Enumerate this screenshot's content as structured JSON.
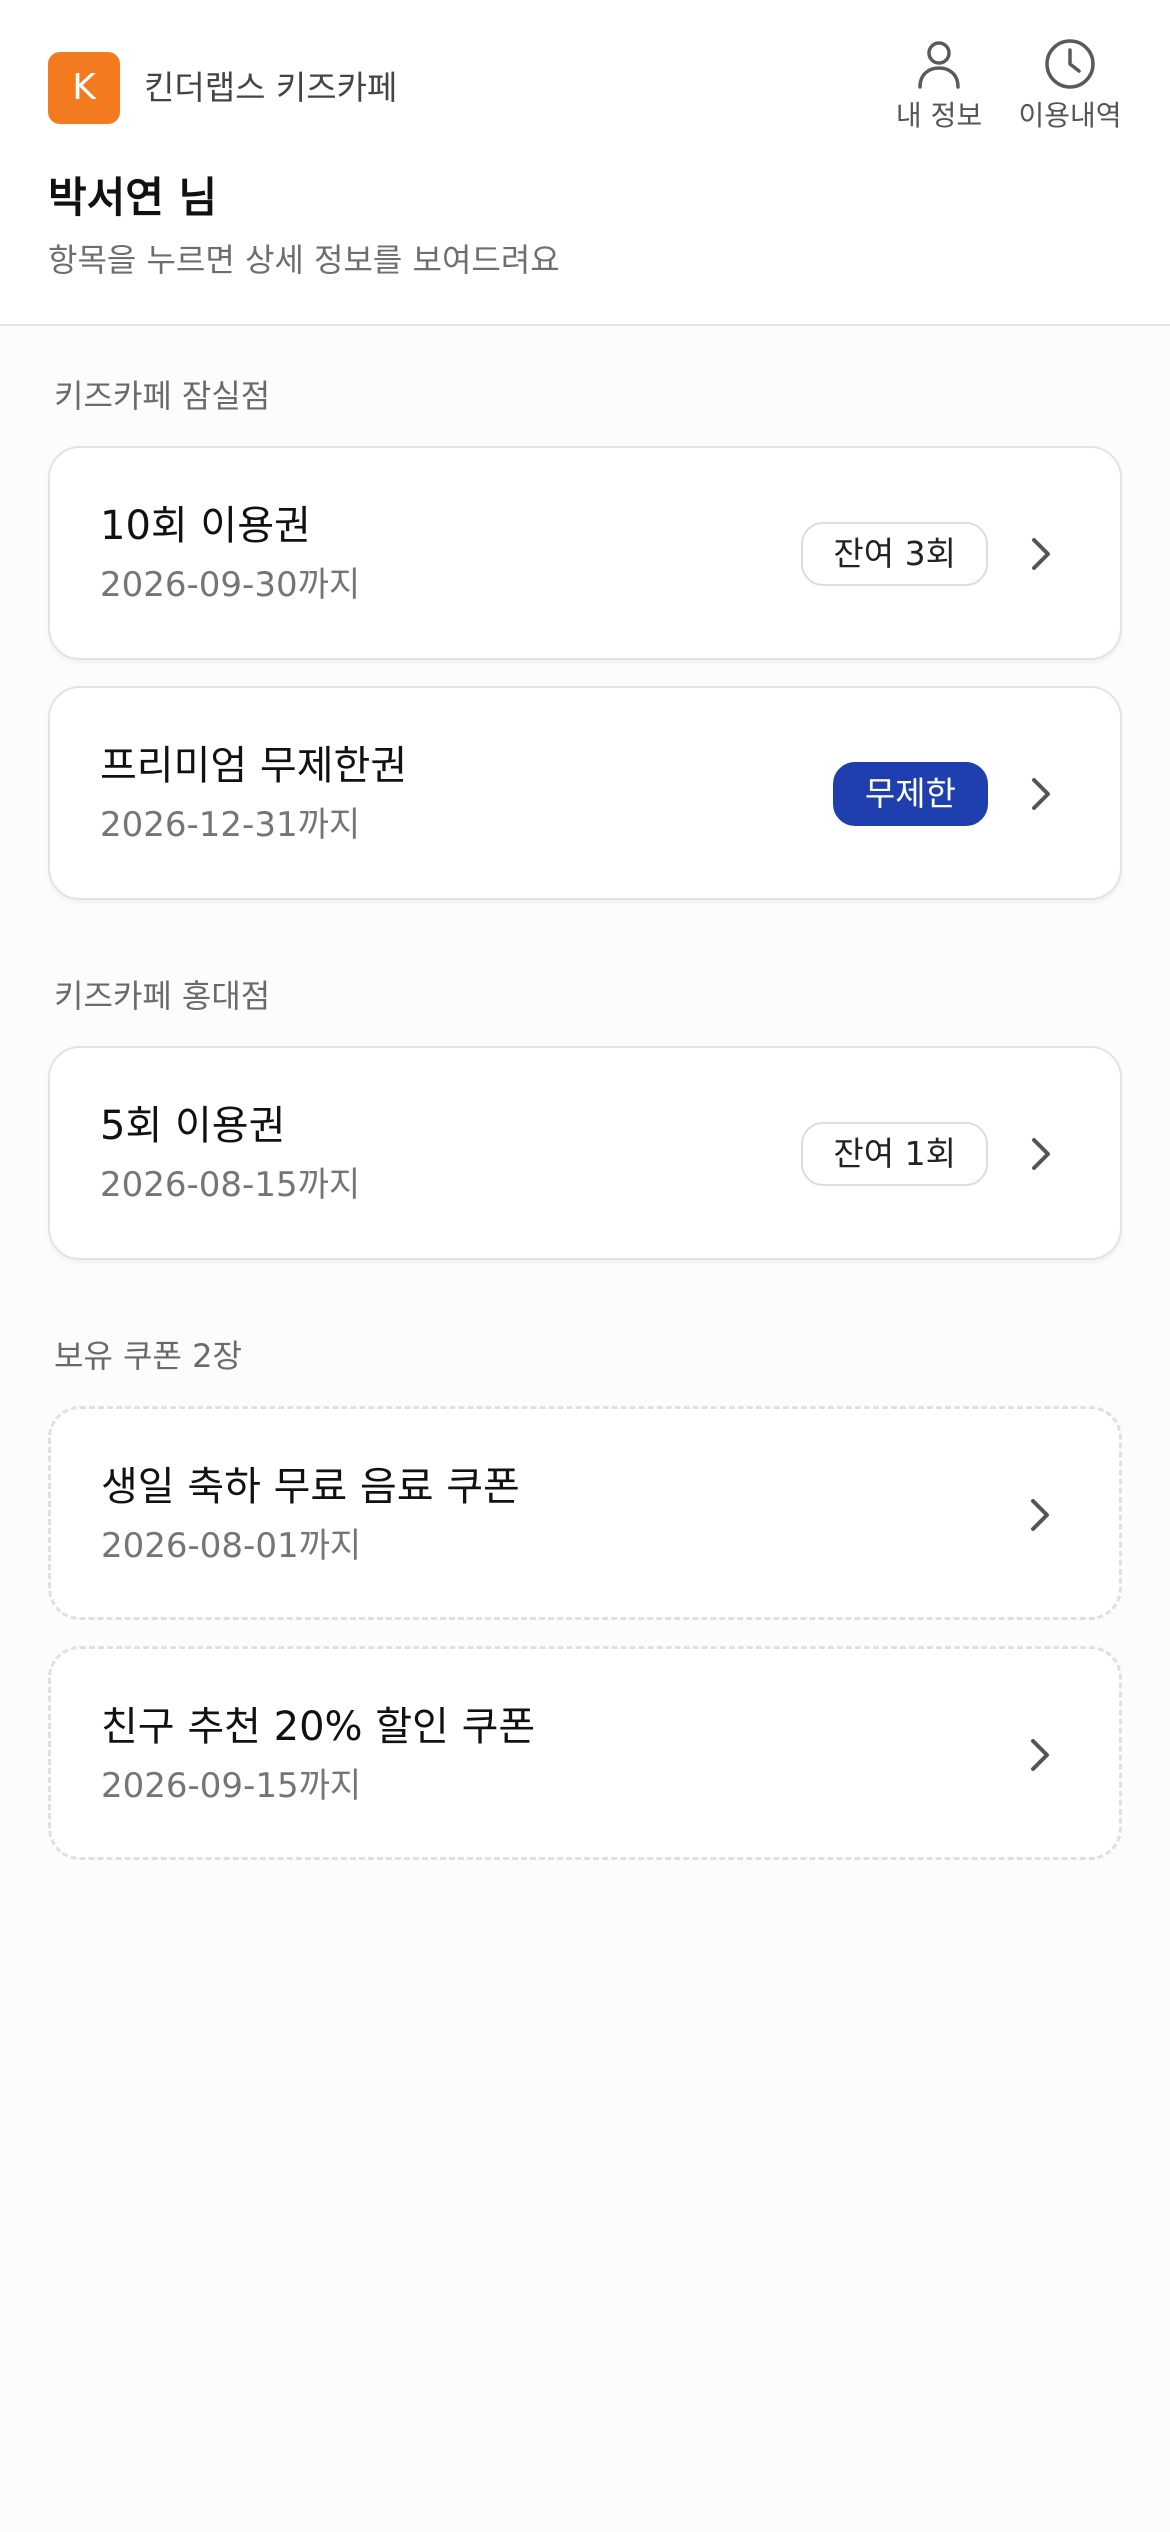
{
  "header": {
    "logo_letter": "K",
    "app_name": "킨더랩스 키즈카페",
    "nav": {
      "profile": {
        "label": "내 정보",
        "icon": "person-icon"
      },
      "history": {
        "label": "이용내역",
        "icon": "clock-icon"
      }
    },
    "user_name": "박서연 님",
    "subtitle": "항목을 누르면 상세 정보를 보여드려요"
  },
  "sections": [
    {
      "title": "키즈카페 잠실점",
      "cards": [
        {
          "title": "10회 이용권",
          "date": "2026-09-30까지",
          "badge": "잔여 3회"
        },
        {
          "title": "프리미엄 무제한권",
          "date": "2026-12-31까지",
          "badge": "무제한"
        }
      ]
    },
    {
      "title": "키즈카페 홍대점",
      "cards": [
        {
          "title": "5회 이용권",
          "date": "2026-08-15까지",
          "badge": "잔여 1회"
        }
      ]
    },
    {
      "title": "보유 쿠폰 2장",
      "cards": [
        {
          "title": "생일 축하 무료 음료 쿠폰",
          "date": "2026-08-01까지"
        },
        {
          "title": "친구 추천 20% 할인 쿠폰",
          "date": "2026-09-15까지"
        }
      ]
    }
  ],
  "colors": {
    "brand": "#f47a20",
    "unlimited_badge": "#1f3fae",
    "background": "#fcfcfc"
  }
}
